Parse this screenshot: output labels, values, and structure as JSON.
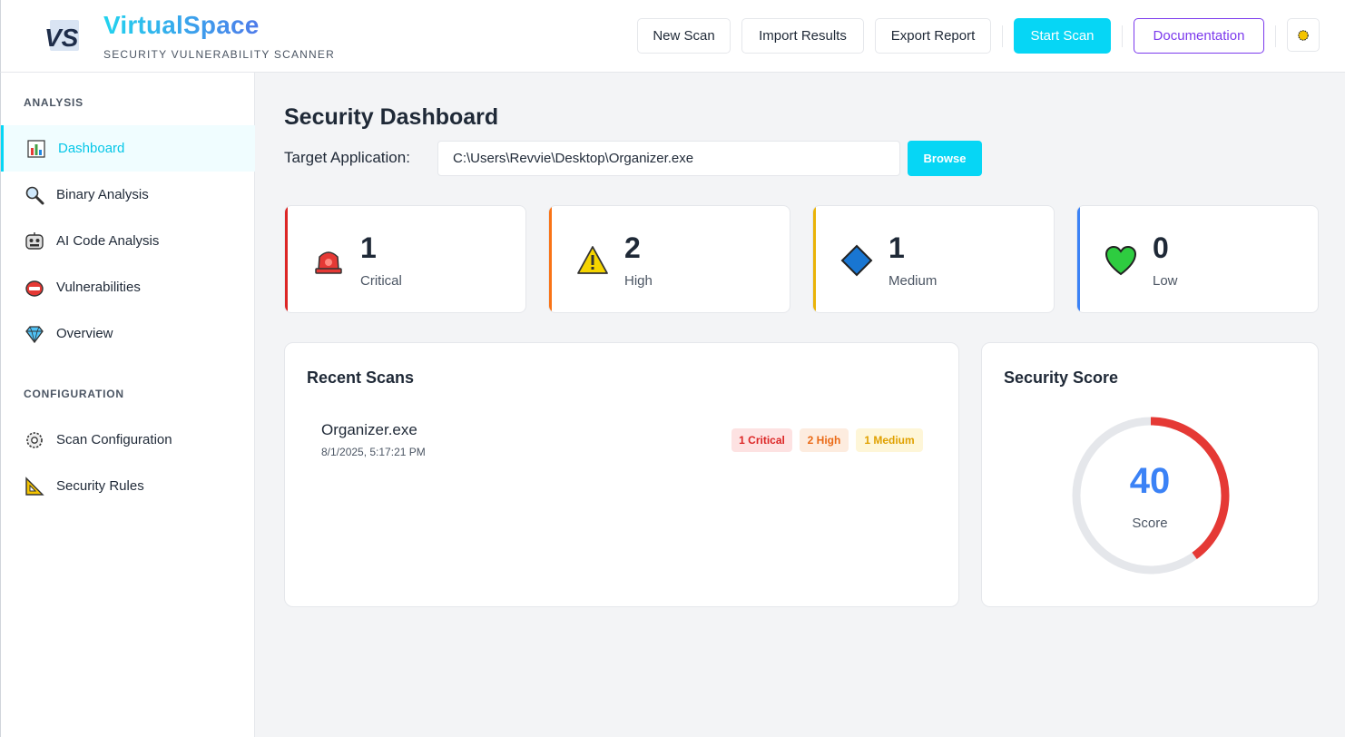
{
  "header": {
    "logo_text": "VS",
    "brand": "VirtualSpace",
    "tagline": "SECURITY VULNERABILITY SCANNER",
    "buttons": {
      "new_scan": "New Scan",
      "import_results": "Import Results",
      "export_report": "Export Report",
      "start_scan": "Start Scan",
      "documentation": "Documentation"
    },
    "settings_icon": "sun-gear-icon"
  },
  "sidebar": {
    "analysis_title": "ANALYSIS",
    "analysis_items": [
      {
        "label": "Dashboard",
        "icon": "bar-chart-icon",
        "active": true
      },
      {
        "label": "Binary Analysis",
        "icon": "magnifier-icon"
      },
      {
        "label": "AI Code Analysis",
        "icon": "robot-icon"
      },
      {
        "label": "Vulnerabilities",
        "icon": "bug-icon"
      },
      {
        "label": "Overview",
        "icon": "diamond-gem-icon"
      }
    ],
    "configuration_title": "CONFIGURATION",
    "configuration_items": [
      {
        "label": "Scan Configuration",
        "icon": "gear-icon"
      },
      {
        "label": "Security Rules",
        "icon": "triangle-ruler-icon"
      }
    ]
  },
  "main": {
    "title": "Security Dashboard",
    "target_label": "Target Application:",
    "target_value": "C:\\Users\\Revvie\\Desktop\\Organizer.exe",
    "browse_label": "Browse",
    "stats": [
      {
        "count": "1",
        "label": "Critical",
        "icon": "siren-icon",
        "color": "#dc2626"
      },
      {
        "count": "2",
        "label": "High",
        "icon": "warning-icon",
        "color": "#f97316"
      },
      {
        "count": "1",
        "label": "Medium",
        "icon": "blue-diamond-icon",
        "color": "#eab308"
      },
      {
        "count": "0",
        "label": "Low",
        "icon": "green-heart-icon",
        "color": "#3b82f6"
      }
    ],
    "recent_scans": {
      "title": "Recent Scans",
      "items": [
        {
          "name": "Organizer.exe",
          "date": "8/1/2025, 5:17:21 PM",
          "badges": [
            "1 Critical",
            "2 High",
            "1 Medium"
          ]
        }
      ]
    },
    "security_score": {
      "title": "Security Score",
      "value": 40,
      "max": 100,
      "label": "Score",
      "track_color": "#e5e7eb",
      "fill_color": "#e53935"
    }
  }
}
